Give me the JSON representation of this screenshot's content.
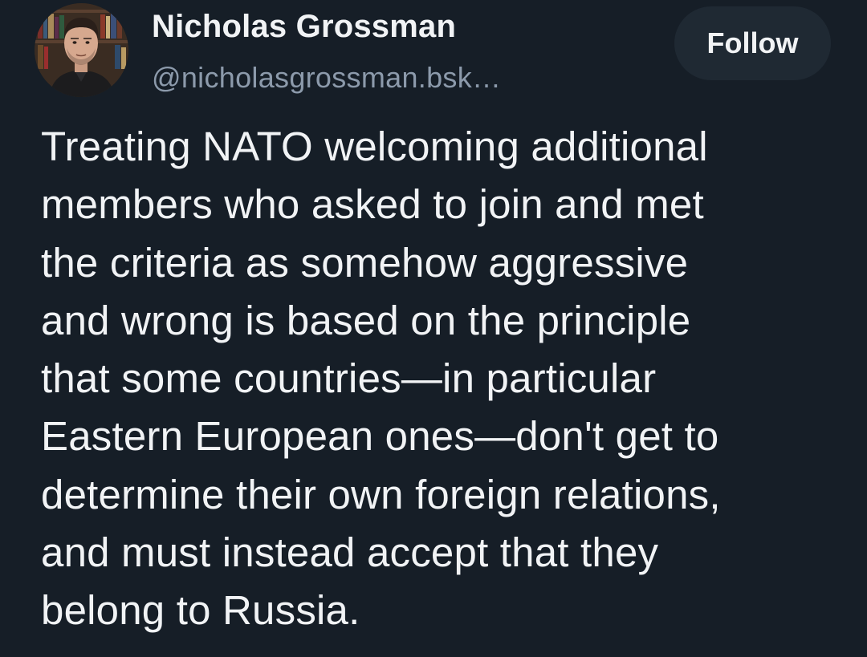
{
  "author": {
    "display_name": "Nicholas Grossman",
    "handle": "@nicholasgrossman.bsk…",
    "avatar_alt": "profile photo"
  },
  "actions": {
    "follow_label": "Follow"
  },
  "post": {
    "lines": [
      "Treating NATO welcoming additional",
      "members who asked to join and met",
      "the criteria as somehow aggressive",
      "and wrong is based on the principle",
      "that some countries—in particular",
      "Eastern European ones—don't get to",
      "determine their own foreign relations,",
      "and must instead accept that they",
      "belong to Russia."
    ]
  },
  "colors": {
    "background": "#161e27",
    "text_primary": "#f1f3f5",
    "text_secondary": "#8c9aab",
    "button_bg": "#1f2933"
  }
}
